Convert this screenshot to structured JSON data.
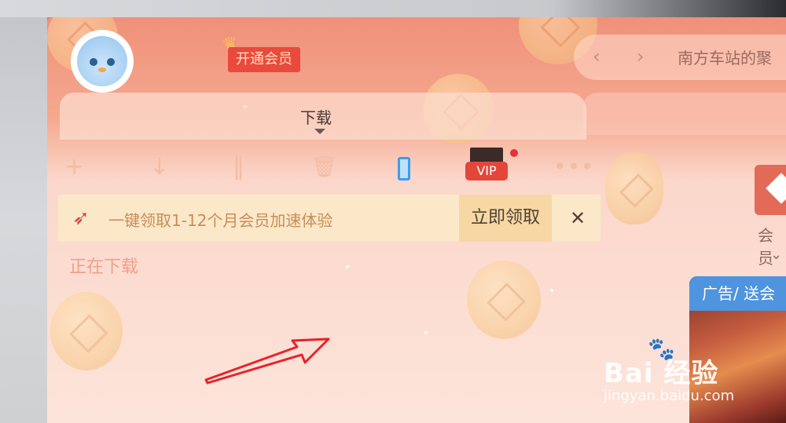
{
  "user": {
    "name_blurred": "",
    "vip_badge": "开通会员"
  },
  "nav": {
    "back_arrow": "‹",
    "forward_arrow": "›",
    "title": "南方车站的聚"
  },
  "tabs": {
    "active": "下载"
  },
  "toolbar": {
    "add": "+",
    "download": "↓",
    "pause": "‖",
    "delete": "🗑",
    "vip_label": "VIP",
    "more": "•••"
  },
  "promo": {
    "text": "一键领取1-12个月会员加速体验",
    "button": "立即领取",
    "close": "✕"
  },
  "section": {
    "downloading": "正在下载"
  },
  "side": {
    "vip_short": "会员",
    "chevron": "⌄"
  },
  "ad": {
    "header": "广告/ 送会"
  },
  "watermark": {
    "brand": "Bai 经验",
    "url": "jingyan.baidu.com",
    "paw": "🐾"
  },
  "colors": {
    "header_top": "#f0907a",
    "body": "#fde4da",
    "vip_red": "#e94a3c",
    "promo_bg": "#fbe8c8",
    "promo_btn": "#f7d7a3",
    "ad_header": "#4f94de",
    "annotation_arrow": "#e8232a"
  }
}
